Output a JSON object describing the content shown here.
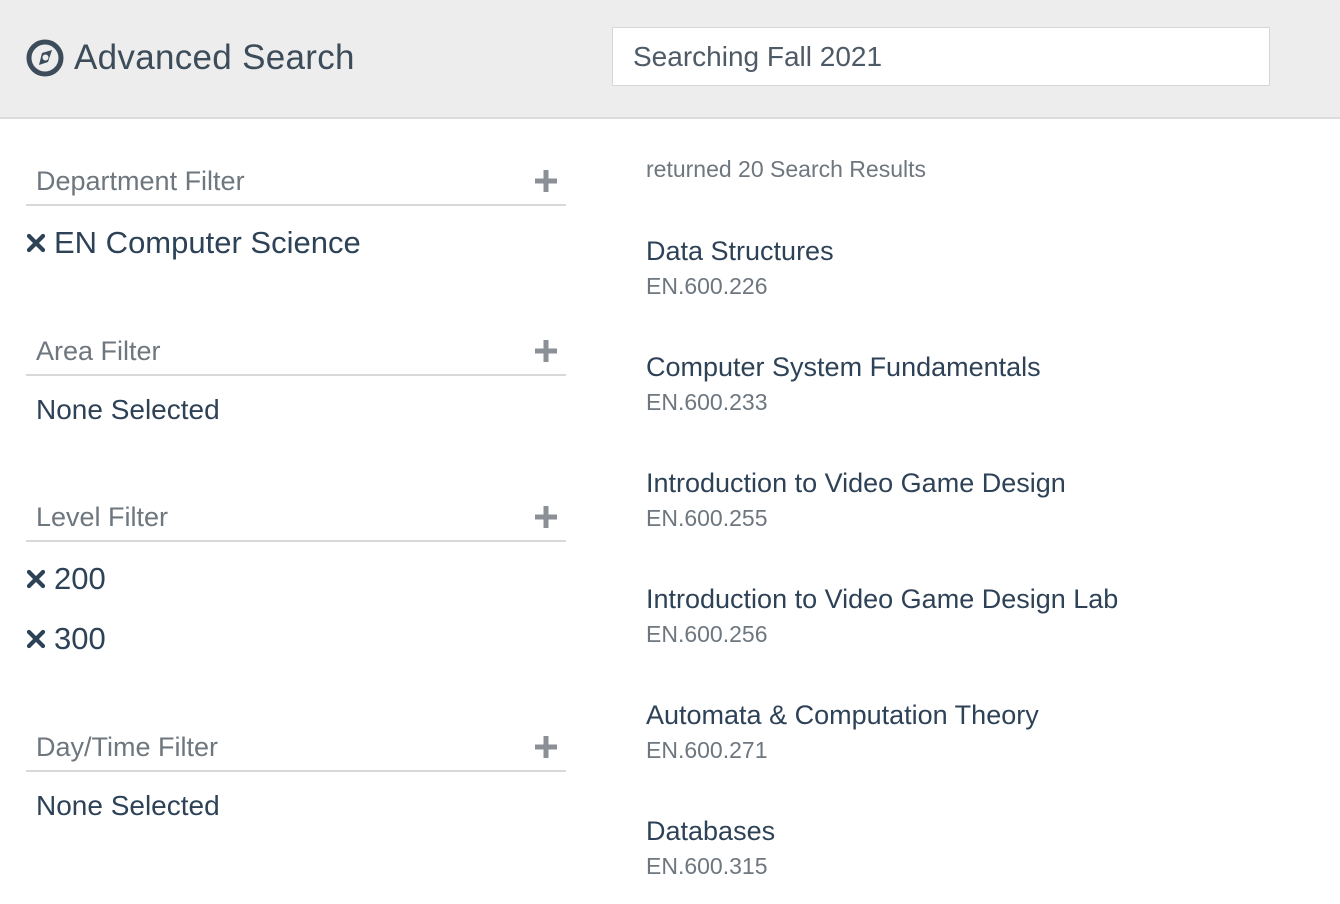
{
  "header": {
    "title": "Advanced Search",
    "logo_icon": "compass-icon",
    "search_value": "Searching Fall 2021"
  },
  "filters": [
    {
      "title": "Department Filter",
      "action_icon": "plus-icon",
      "selected": [
        "EN Computer Science"
      ],
      "empty_text": ""
    },
    {
      "title": "Area Filter",
      "action_icon": "plus-icon",
      "selected": [],
      "empty_text": "None Selected"
    },
    {
      "title": "Level Filter",
      "action_icon": "plus-icon",
      "selected": [
        "200",
        "300"
      ],
      "empty_text": ""
    },
    {
      "title": "Day/Time Filter",
      "action_icon": "plus-icon",
      "selected": [],
      "empty_text": "None Selected"
    }
  ],
  "results": {
    "count_text": "returned 20 Search Results",
    "items": [
      {
        "title": "Data Structures",
        "code": "EN.600.226"
      },
      {
        "title": "Computer System Fundamentals",
        "code": "EN.600.233"
      },
      {
        "title": "Introduction to Video Game Design",
        "code": "EN.600.255"
      },
      {
        "title": "Introduction to Video Game Design Lab",
        "code": "EN.600.256"
      },
      {
        "title": "Automata & Computation Theory",
        "code": "EN.600.271"
      },
      {
        "title": "Databases",
        "code": "EN.600.315"
      }
    ]
  },
  "colors": {
    "header_bg": "#ededed",
    "text_primary": "#2e4257",
    "text_secondary": "#6e767e"
  }
}
